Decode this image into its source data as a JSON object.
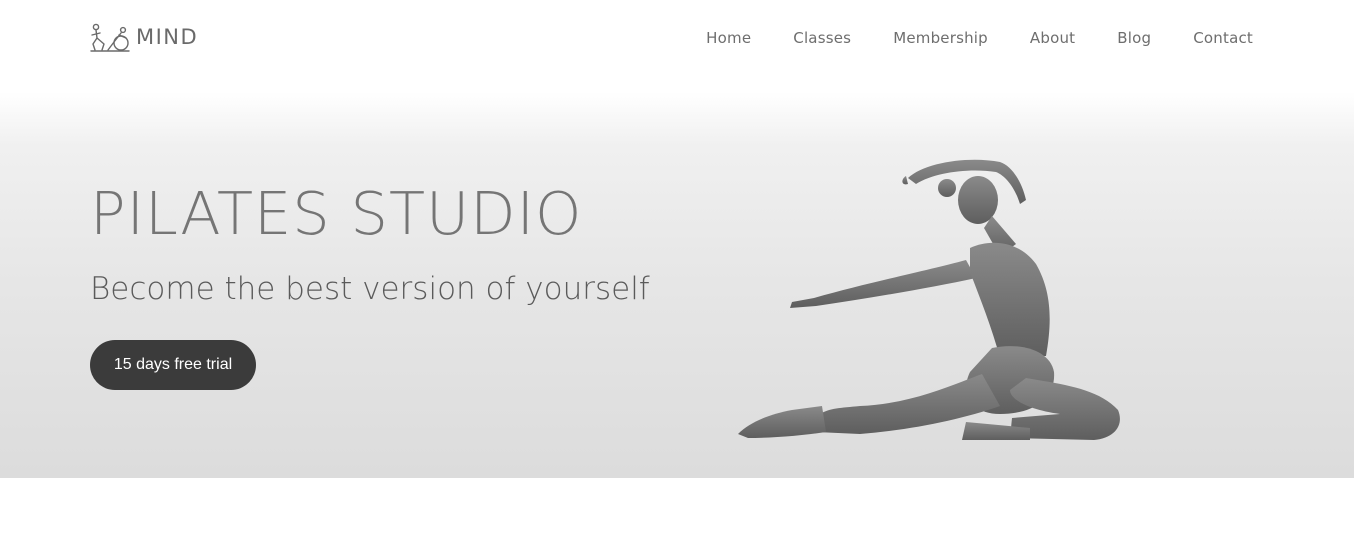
{
  "brand": {
    "name": "MIND",
    "logo_icon": "pilates-figures-icon"
  },
  "nav": {
    "items": [
      {
        "label": "Home"
      },
      {
        "label": "Classes"
      },
      {
        "label": "Membership"
      },
      {
        "label": "About"
      },
      {
        "label": "Blog"
      },
      {
        "label": "Contact"
      }
    ]
  },
  "hero": {
    "title": "PILATES STUDIO",
    "subtitle": "Become the best version of yourself",
    "cta_label": "15 days free trial",
    "image_subject": "woman-pilates-pose-image"
  },
  "colors": {
    "button_bg": "#3b3b3b",
    "button_text": "#ffffff",
    "text_primary": "#757575",
    "hero_bg": "#e6e6e6"
  }
}
